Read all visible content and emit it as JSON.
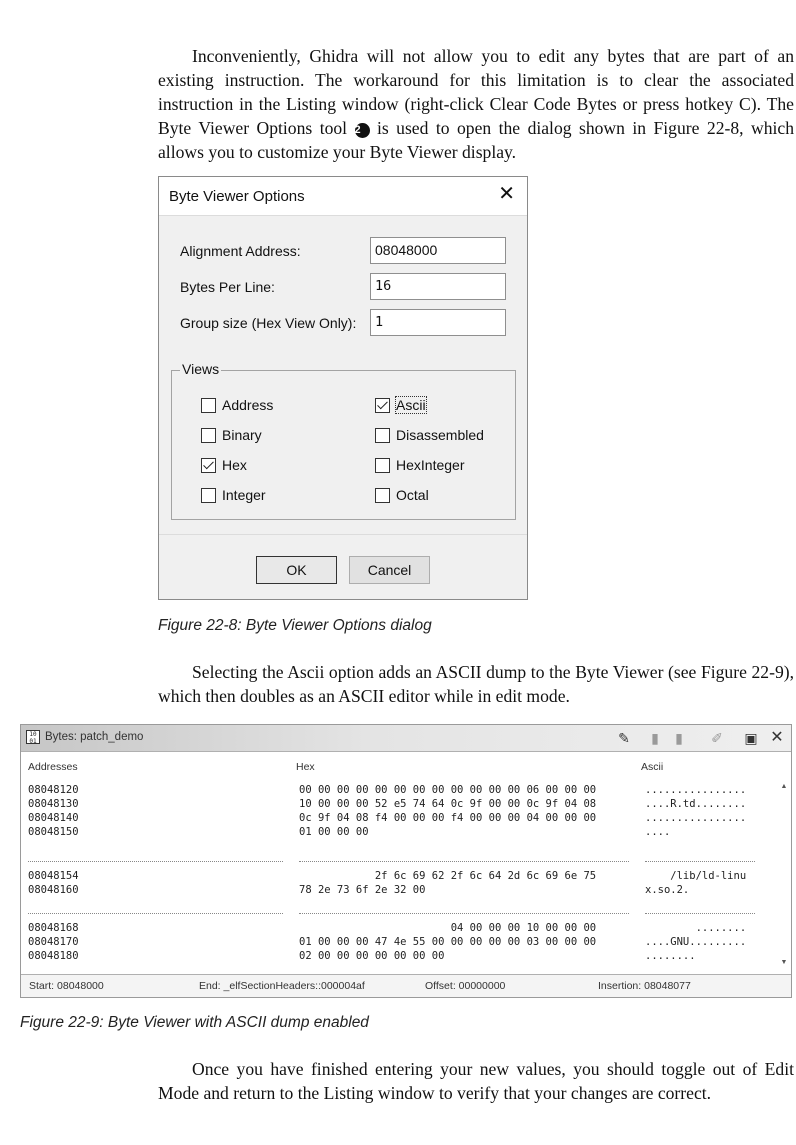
{
  "paragraphs": {
    "p1_before_marker": "Inconveniently, Ghidra will not allow you to edit any bytes that are part of an existing instruction. The workaround for this limitation is to clear the associated instruction in the Listing window (right-click Clear Code Bytes or press hotkey C). The Byte Viewer Options tool",
    "p1_marker": "2",
    "p1_after_marker": "is used to open the dialog shown in Figure 22-8, which allows you to customize your Byte Viewer display.",
    "p2": "Selecting the Ascii option adds an ASCII dump to the Byte Viewer (see Figure 22-9), which then doubles as an ASCII editor while in edit mode.",
    "p3": "Once you have finished entering your new values, you should toggle out of Edit Mode and return to the Listing window to verify that your changes are correct."
  },
  "figure1": {
    "caption": "Figure 22-8: Byte Viewer Options dialog",
    "dialog": {
      "title": "Byte Viewer Options",
      "close_glyph": "✕",
      "fields": [
        {
          "label": "Alignment Address:",
          "value": "08048000"
        },
        {
          "label": "Bytes Per Line:",
          "value": "16"
        },
        {
          "label": "Group size (Hex View Only):",
          "value": "1"
        }
      ],
      "views_legend": "Views",
      "views": [
        {
          "label": "Address",
          "checked": false
        },
        {
          "label": "Ascii",
          "checked": true
        },
        {
          "label": "Binary",
          "checked": false
        },
        {
          "label": "Disassembled",
          "checked": false
        },
        {
          "label": "Hex",
          "checked": true
        },
        {
          "label": "HexInteger",
          "checked": false
        },
        {
          "label": "Integer",
          "checked": false
        },
        {
          "label": "Octal",
          "checked": false
        }
      ],
      "ok_label": "OK",
      "cancel_label": "Cancel"
    }
  },
  "figure2": {
    "caption": "Figure 22-9: Byte Viewer with ASCII dump enabled",
    "window": {
      "icon_text": "10\n01",
      "title": "Bytes: patch_demo",
      "toolbar_icons": [
        "edit-toggle-icon",
        "snapshot-icon",
        "copy-icon",
        "pencil-icon",
        "options-icon",
        "close-icon"
      ],
      "close_glyph": "✕",
      "headers": {
        "addresses": "Addresses",
        "hex": "Hex",
        "ascii": "Ascii"
      },
      "addresses_block1": "08048120\n08048130\n08048140\n08048150",
      "hex_block1": "00 00 00 00 00 00 00 00 00 00 00 00 06 00 00 00\n10 00 00 00 52 e5 74 64 0c 9f 00 00 0c 9f 04 08\n0c 9f 04 08 f4 00 00 00 f4 00 00 00 04 00 00 00\n01 00 00 00",
      "ascii_block1": "................\n....R.td........\n................\n....",
      "addresses_block2": "08048154\n08048160",
      "hex_block2": "            2f 6c 69 62 2f 6c 64 2d 6c 69 6e 75\n78 2e 73 6f 2e 32 00",
      "ascii_block2": "    /lib/ld-linu\nx.so.2.",
      "addresses_block3": "08048168\n08048170\n08048180",
      "hex_block3": "                        04 00 00 00 10 00 00 00\n01 00 00 00 47 4e 55 00 00 00 00 00 03 00 00 00\n02 00 00 00 00 00 00 00",
      "ascii_block3": "        ........\n....GNU.........\n........",
      "status": {
        "start": "Start: 08048000",
        "end": "End: _elfSectionHeaders::000004af",
        "offset": "Offset: 00000000",
        "insertion": "Insertion: 08048077"
      }
    }
  }
}
